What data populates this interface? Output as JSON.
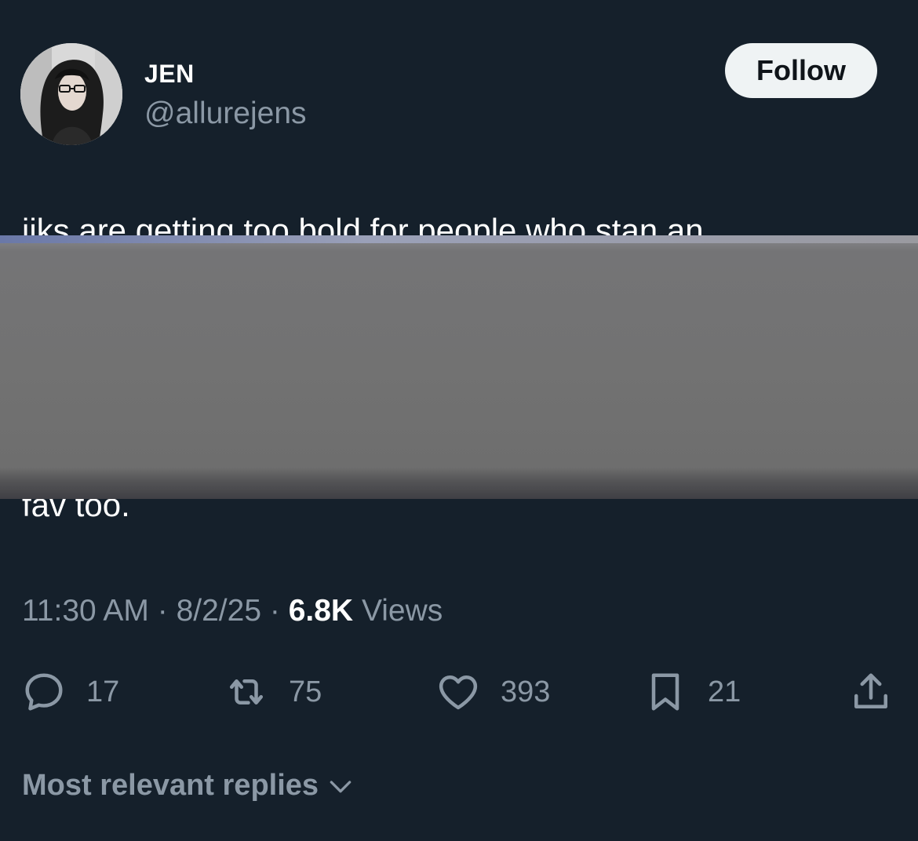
{
  "author": {
    "display_name": "JEN",
    "handle": "@allurejens",
    "avatar_icon": "profile-photo"
  },
  "follow_button": {
    "label": "Follow"
  },
  "tweet": {
    "line_1_visible": "iiks are getting too bold for people who stan an",
    "line_2_visible": "fav too.",
    "redacted": true
  },
  "meta": {
    "time": "11:30 AM",
    "separator": "·",
    "date": "8/2/25",
    "views_count": "6.8K",
    "views_label": "Views"
  },
  "actions": {
    "replies": {
      "icon": "reply-icon",
      "count": "17"
    },
    "reposts": {
      "icon": "retweet-icon",
      "count": "75"
    },
    "likes": {
      "icon": "heart-icon",
      "count": "393"
    },
    "bookmarks": {
      "icon": "bookmark-icon",
      "count": "21"
    },
    "share": {
      "icon": "share-icon"
    }
  },
  "replies_sort": {
    "label": "Most relevant replies"
  },
  "colors": {
    "background": "#15202b",
    "secondary_text": "#8b98a5",
    "primary_text": "#ffffff",
    "button_bg": "#eff3f4"
  }
}
